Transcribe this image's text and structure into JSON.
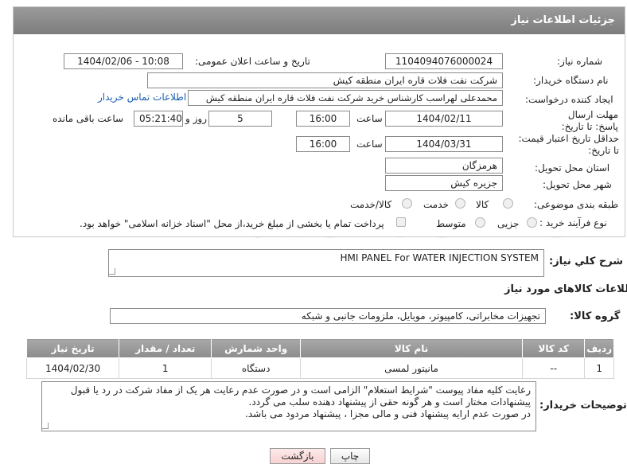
{
  "header": {
    "title": "جزئیات اطلاعات نیاز"
  },
  "fields": {
    "need_number_label": "شماره نیاز:",
    "need_number": "1104094076000024",
    "announce_label": "تاریخ و ساعت اعلان عمومی:",
    "announce_value": "1404/02/06 - 10:08",
    "buyer_org_label": "نام دستگاه خریدار:",
    "buyer_org": "شرکت نفت فلات قاره ایران منطقه کیش",
    "creator_label": "ایجاد کننده درخواست:",
    "creator": "محمدعلی لهراسب کارشناس خرید شرکت نفت فلات قاره ایران منطقه کیش",
    "contact_link": "اطلاعات تماس خریدار",
    "reply_deadline_label": "مهلت ارسال پاسخ: تا تاریخ:",
    "reply_date": "1404/02/11",
    "time_label": "ساعت",
    "reply_time": "16:00",
    "days_value": "5",
    "days_label": "روز و",
    "remaining_time": "05:21:40",
    "remaining_label": "ساعت باقی مانده",
    "price_validity_label": "حداقل تاریخ اعتبار قیمت: تا تاریخ:",
    "price_date": "1404/03/31",
    "price_time": "16:00",
    "province_label": "استان محل تحویل:",
    "province": "هرمزگان",
    "city_label": "شهر محل تحویل:",
    "city": "جزیره کیش",
    "category_label": "طبقه بندی موضوعی:",
    "category_options": [
      "کالا",
      "خدمت",
      "کالا/خدمت"
    ],
    "purchase_type_label": "نوع فرآیند خرید :",
    "purchase_options": [
      "جزیی",
      "متوسط"
    ],
    "payment_note": "پرداخت تمام یا بخشی از مبلغ خرید،از محل \"اسناد خزانه اسلامی\" خواهد بود."
  },
  "description": {
    "label": "شرح كلي نياز:",
    "value": "HMI PANEL For WATER INJECTION SYSTEM"
  },
  "goods": {
    "section_title": "اطلاعات کالاهای مورد نیاز",
    "group_label": "گروه کالا:",
    "group_value": "تجهیزات مخابراتی، کامپیوتر، موبایل، ملزومات جانبی و شبکه",
    "columns": [
      "ردیف",
      "کد کالا",
      "نام کالا",
      "واحد شمارش",
      "تعداد / مقدار",
      "تاریخ نیاز"
    ],
    "rows": [
      [
        "1",
        "--",
        "مانیتور لمسی",
        "دستگاه",
        "1",
        "1404/02/30"
      ]
    ]
  },
  "buyer_notes": {
    "label": "توضیحات خریدار:",
    "lines": [
      "رعایت کلیه مفاد  پیوست \"شرایط استعلام\" الزامی است و در صورت عدم رعایت هر یک از مفاد شرکت در رد یا قبول",
      "پیشنهادات مختار است  و هر گونه حقی از پیشنهاد دهنده سلب می گردد.",
      "در صورت عدم ارایه پیشنهاد فنی و مالی مجزا ، پیشنهاد مردود می باشد."
    ]
  },
  "buttons": {
    "print": "چاپ",
    "back": "بازگشت"
  },
  "watermark": "AriaTender.neT",
  "colors": {
    "header": "#8a8a8a",
    "link": "#1a5fb4",
    "back_button": "#f7d2d2"
  }
}
